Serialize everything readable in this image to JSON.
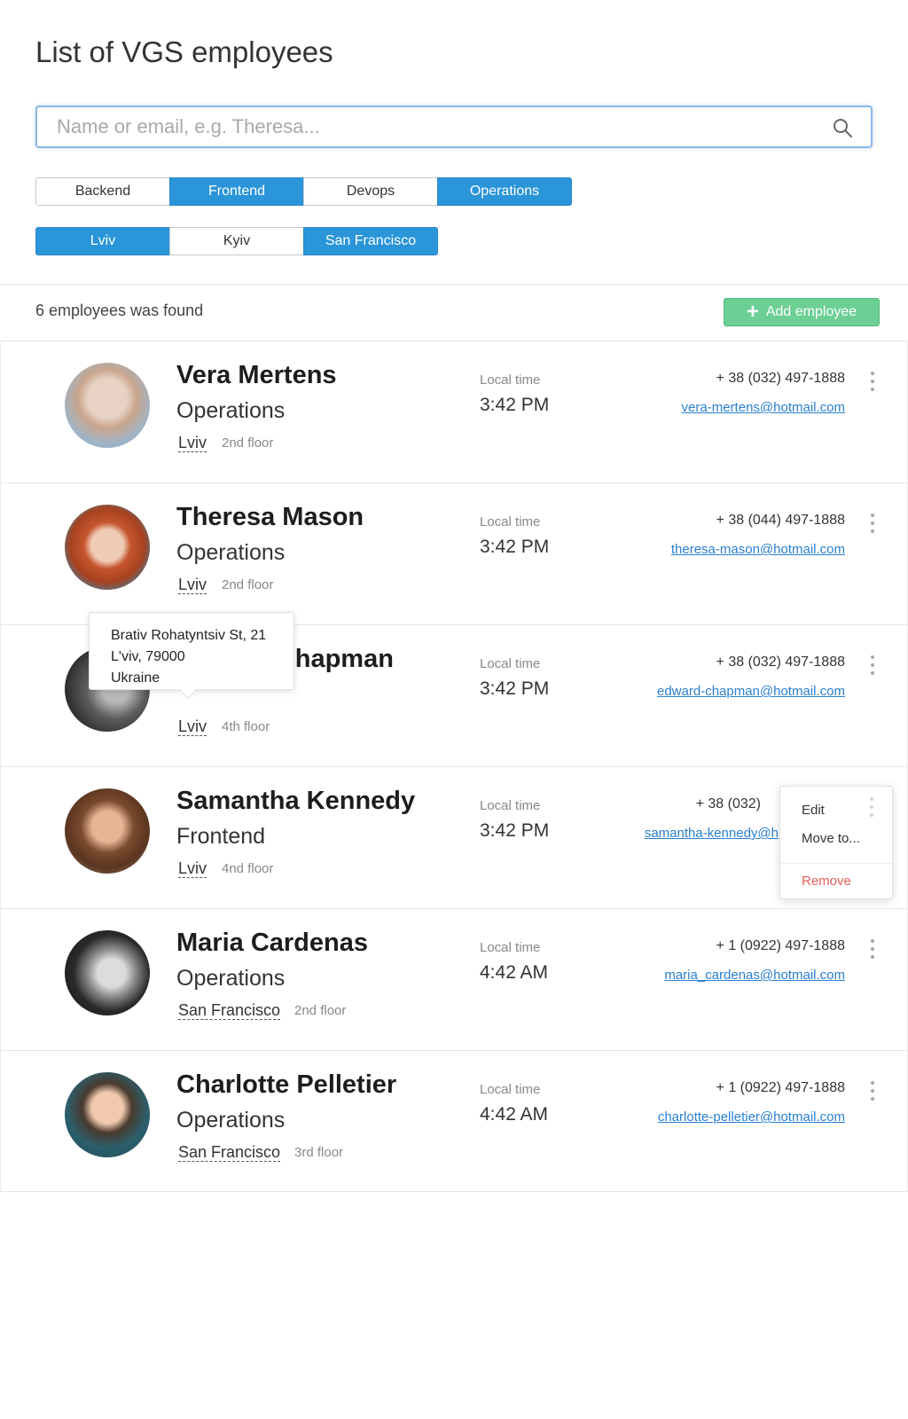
{
  "page": {
    "title": "List of VGS employees"
  },
  "search": {
    "placeholder": "Name or email, e.g. Theresa...",
    "value": "",
    "icon": "search-icon"
  },
  "filters": {
    "departments": [
      {
        "label": "Backend",
        "selected": false
      },
      {
        "label": "Frontend",
        "selected": true
      },
      {
        "label": "Devops",
        "selected": false
      },
      {
        "label": "Operations",
        "selected": true
      }
    ],
    "cities": [
      {
        "label": "Lviv",
        "selected": true
      },
      {
        "label": "Kyiv",
        "selected": false
      },
      {
        "label": "San Francisco",
        "selected": true
      }
    ]
  },
  "results": {
    "count_text": "6 employees was found",
    "add_button_label": "Add employee"
  },
  "colors": {
    "accent": "#2b95d9",
    "add_button": "#6ccf94",
    "link": "#2a7fd1",
    "danger": "#e4605a"
  },
  "local_time_label": "Local time",
  "employees": [
    {
      "name": "Vera Mertens",
      "department": "Operations",
      "city": "Lviv",
      "floor": "2nd floor",
      "time": "3:42 PM",
      "phone": "+ 38 (032) 497-1888",
      "email": "vera-mertens@hotmail.com"
    },
    {
      "name": "Theresa Mason",
      "department": "Operations",
      "city": "Lviv",
      "floor": "2nd floor",
      "time": "3:42 PM",
      "phone": "+ 38 (044) 497-1888",
      "email": "theresa-mason@hotmail.com"
    },
    {
      "name": "Edward Chapman",
      "department": "",
      "city": "Lviv",
      "floor": "4th floor",
      "time": "3:42 PM",
      "phone": "+ 38 (032) 497-1888",
      "email": "edward-chapman@hotmail.com"
    },
    {
      "name": "Samantha Kennedy",
      "department": "Frontend",
      "city": "Lviv",
      "floor": "4nd floor",
      "time": "3:42 PM",
      "phone": "+ 38 (032)",
      "email": "samantha-kennedy@h"
    },
    {
      "name": "Maria Cardenas",
      "department": "Operations",
      "city": "San Francisco",
      "floor": "2nd floor",
      "time": "4:42 AM",
      "phone": "+ 1 (0922) 497-1888",
      "email": "maria_cardenas@hotmail.com"
    },
    {
      "name": "Charlotte Pelletier",
      "department": "Operations",
      "city": "San Francisco",
      "floor": "3rd floor",
      "time": "4:42 AM",
      "phone": "+ 1 (0922) 497-1888",
      "email": "charlotte-pelletier@hotmail.com"
    }
  ],
  "tooltip": {
    "line1": "Brativ Rohatyntsiv St, 21",
    "line2": "L'viv, 79000",
    "line3": "Ukraine"
  },
  "context_menu": {
    "edit": "Edit",
    "move": "Move to...",
    "remove": "Remove"
  }
}
